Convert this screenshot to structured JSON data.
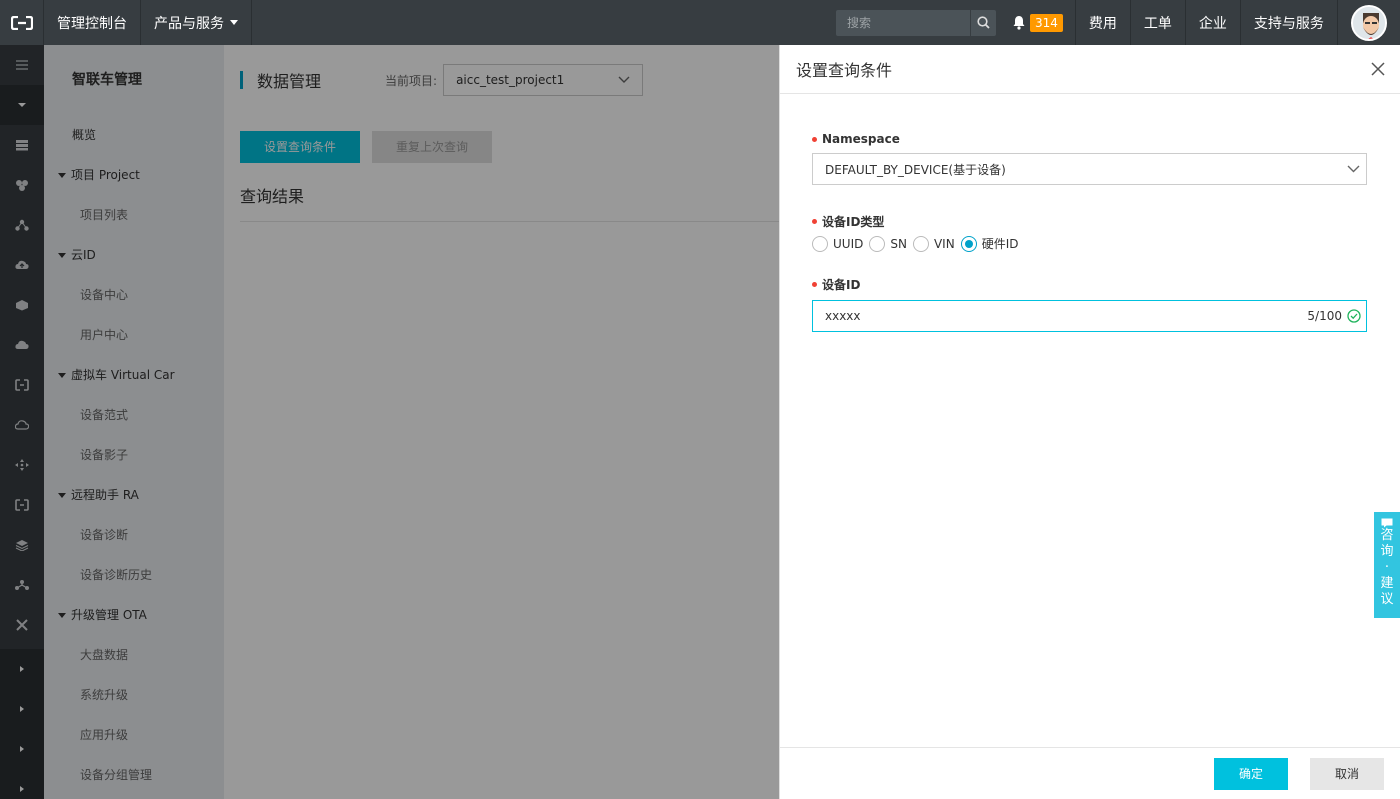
{
  "topbar": {
    "console": "管理控制台",
    "products": "产品与服务",
    "search_placeholder": "搜索",
    "notification_count": "314",
    "menu": [
      "费用",
      "工单",
      "企业",
      "支持与服务"
    ]
  },
  "sidebar": {
    "title": "智联车管理",
    "overview": "概览",
    "groups": [
      {
        "label": "项目 Project",
        "items": [
          "项目列表"
        ]
      },
      {
        "label": "云ID",
        "items": [
          "设备中心",
          "用户中心"
        ]
      },
      {
        "label": "虚拟车 Virtual Car",
        "items": [
          "设备范式",
          "设备影子"
        ]
      },
      {
        "label": "远程助手 RA",
        "items": [
          "设备诊断",
          "设备诊断历史"
        ]
      },
      {
        "label": "升级管理 OTA",
        "items": [
          "大盘数据",
          "系统升级",
          "应用升级",
          "设备分组管理"
        ]
      }
    ]
  },
  "main": {
    "title": "数据管理",
    "project_label": "当前项目:",
    "project_value": "aicc_test_project1",
    "btn_set_query": "设置查询条件",
    "btn_repeat_query": "重复上次查询",
    "result_title": "查询结果"
  },
  "drawer": {
    "title": "设置查询条件",
    "namespace_label": "Namespace",
    "namespace_value": "DEFAULT_BY_DEVICE(基于设备)",
    "id_type_label": "设备ID类型",
    "id_types": [
      "UUID",
      "SN",
      "VIN",
      "硬件ID"
    ],
    "id_type_selected": "硬件ID",
    "device_id_label": "设备ID",
    "device_id_value": "xxxxx",
    "device_id_counter": "5/100",
    "ok": "确定",
    "cancel": "取消"
  },
  "feedback_tab": {
    "text": "咨询·建议"
  },
  "colors": {
    "accent": "#00c1de",
    "topbar": "#373d41",
    "badge": "#ff9900"
  }
}
